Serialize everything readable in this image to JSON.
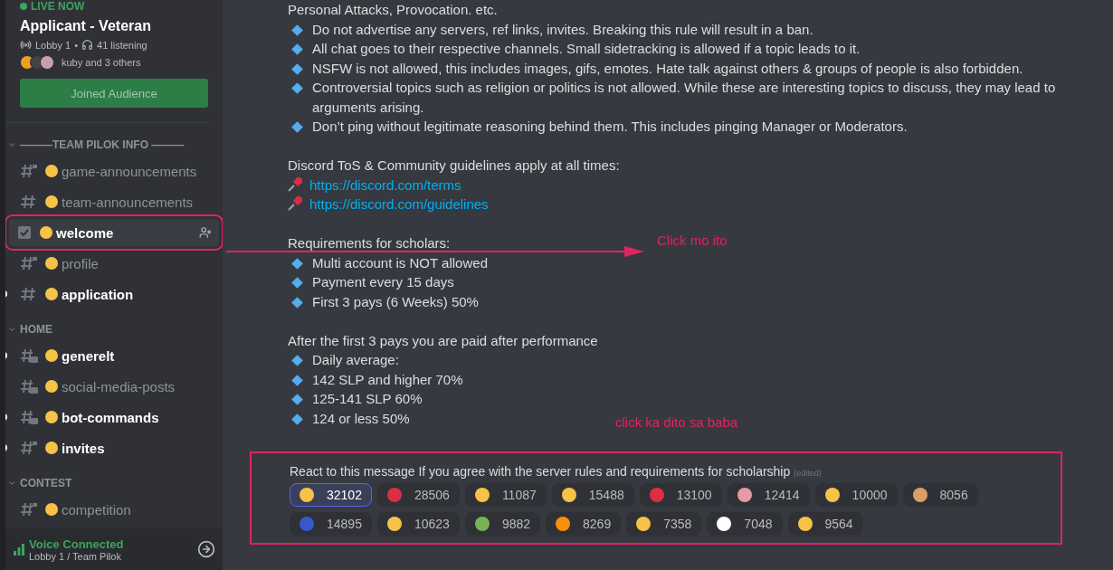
{
  "stage": {
    "status": "LIVE NOW",
    "title": "Applicant - Veteran",
    "room": "Lobby 1",
    "separator": "•",
    "listeners": "41 listening",
    "audience": "kuby and 3 others",
    "button": "Joined Audience"
  },
  "categories": [
    {
      "name": "———TEAM PILOK INFO ———",
      "expanded": true,
      "channels": [
        {
          "name": "game-announcements",
          "kind": "locked",
          "unread": false,
          "selected": false,
          "annotated": false
        },
        {
          "name": "team-announcements",
          "kind": "text",
          "unread": false,
          "selected": false,
          "annotated": false
        },
        {
          "name": "welcome",
          "kind": "rules",
          "unread": false,
          "selected": true,
          "annotated": true
        },
        {
          "name": "profile",
          "kind": "locked",
          "unread": false,
          "selected": false,
          "annotated": false
        },
        {
          "name": "application",
          "kind": "text",
          "unread": true,
          "selected": false,
          "annotated": false
        }
      ]
    },
    {
      "name": "HOME",
      "expanded": true,
      "channels": [
        {
          "name": "generelt",
          "kind": "thread",
          "unread": true,
          "selected": false,
          "annotated": false
        },
        {
          "name": "social-media-posts",
          "kind": "thread",
          "unread": false,
          "selected": false,
          "annotated": false
        },
        {
          "name": "bot-commands",
          "kind": "thread",
          "unread": true,
          "selected": false,
          "annotated": false
        },
        {
          "name": "invites",
          "kind": "locked",
          "unread": true,
          "selected": false,
          "annotated": false
        }
      ]
    },
    {
      "name": "CONTEST",
      "expanded": true,
      "channels": [
        {
          "name": "competition",
          "kind": "locked",
          "unread": false,
          "selected": false,
          "annotated": false
        }
      ]
    }
  ],
  "voice": {
    "status": "Voice Connected",
    "location": "Lobby 1 / Team Pilok"
  },
  "message": {
    "lines": [
      {
        "kind": "plain",
        "text": "Personal Attacks, Provocation. etc."
      },
      {
        "kind": "bullet",
        "text": "Do not advertise any servers, ref links, invites. Breaking this rule will result in a ban."
      },
      {
        "kind": "bullet",
        "text": "All chat goes to their respective channels. Small sidetracking is allowed if a topic leads to it."
      },
      {
        "kind": "bullet",
        "text": "NSFW is not allowed, this includes images, gifs, emotes. Hate talk against others & groups of people is also forbidden."
      },
      {
        "kind": "bullet",
        "text": "Controversial topics such as religion or politics is not allowed. While these are interesting topics to discuss, they may lead to arguments arising."
      },
      {
        "kind": "bullet",
        "text": "Don’t ping without legitimate reasoning behind them. This includes pinging Manager or Moderators."
      },
      {
        "kind": "blank"
      },
      {
        "kind": "plain",
        "text": "Discord ToS & Community guidelines apply at all times:"
      },
      {
        "kind": "link",
        "text": "https://discord.com/terms"
      },
      {
        "kind": "link",
        "text": "https://discord.com/guidelines"
      },
      {
        "kind": "blank"
      },
      {
        "kind": "plain",
        "text": "Requirements for scholars:"
      },
      {
        "kind": "bullet",
        "text": "Multi account is NOT allowed"
      },
      {
        "kind": "bullet",
        "text": "Payment every 15 days"
      },
      {
        "kind": "bullet",
        "text": "First 3 pays (6 Weeks) 50%"
      },
      {
        "kind": "blank"
      },
      {
        "kind": "plain",
        "text": "After the first 3 pays you are paid after performance"
      },
      {
        "kind": "bullet",
        "text": "Daily average:"
      },
      {
        "kind": "bullet",
        "text": "142 SLP and higher 70%"
      },
      {
        "kind": "bullet",
        "text": "125-141 SLP 60%"
      },
      {
        "kind": "bullet",
        "text": "124 or less 50%"
      }
    ]
  },
  "reaction_message": {
    "text": "React to this message If you agree with the server rules and requirements for scholarship",
    "edited": "(edited)",
    "annotated": true,
    "reactions": [
      {
        "count": "32102",
        "selected": true,
        "color": "#f7c248"
      },
      {
        "count": "28506",
        "selected": false,
        "color": "#dd2e44"
      },
      {
        "count": "11087",
        "selected": false,
        "color": "#f7c248"
      },
      {
        "count": "15488",
        "selected": false,
        "color": "#f7c248"
      },
      {
        "count": "13100",
        "selected": false,
        "color": "#dd2e44"
      },
      {
        "count": "12414",
        "selected": false,
        "color": "#e59aa6"
      },
      {
        "count": "10000",
        "selected": false,
        "color": "#f7c248"
      },
      {
        "count": "8056",
        "selected": false,
        "color": "#d9a066"
      },
      {
        "count": "14895",
        "selected": false,
        "color": "#3858c8"
      },
      {
        "count": "10623",
        "selected": false,
        "color": "#f7c248"
      },
      {
        "count": "9882",
        "selected": false,
        "color": "#77b255"
      },
      {
        "count": "8269",
        "selected": false,
        "color": "#f4900c"
      },
      {
        "count": "7358",
        "selected": false,
        "color": "#f7c248"
      },
      {
        "count": "7048",
        "selected": false,
        "color": "#ffffff"
      },
      {
        "count": "9564",
        "selected": false,
        "color": "#f7c248"
      }
    ]
  },
  "annotations": [
    {
      "kind": "arrow",
      "text": "Click mo ito"
    },
    {
      "kind": "note",
      "text": "click ka dito sa baba"
    }
  ]
}
